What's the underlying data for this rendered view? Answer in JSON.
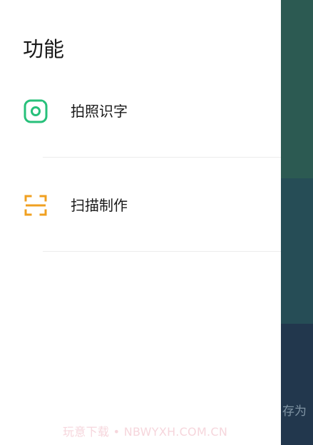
{
  "drawer": {
    "title": "功能",
    "items": [
      {
        "label": "拍照识字",
        "icon": "camera-icon",
        "color": "#27c07a"
      },
      {
        "label": "扫描制作",
        "icon": "scan-icon",
        "color": "#f0a020"
      }
    ]
  },
  "background": {
    "partial_text": "存为"
  },
  "watermark": "玩意下载 • NBWYXH.COM.CN"
}
